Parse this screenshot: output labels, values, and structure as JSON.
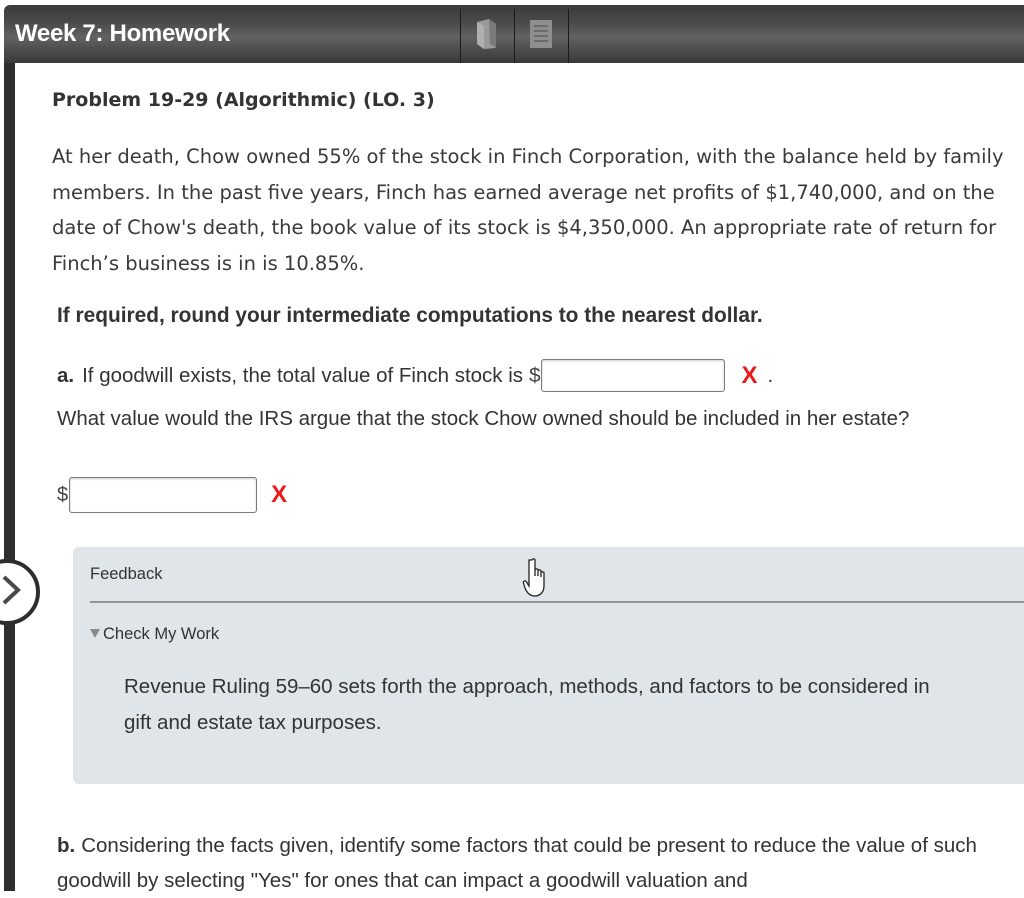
{
  "header": {
    "title": "Week 7: Homework",
    "icons": [
      "book-icon",
      "document-icon"
    ]
  },
  "problem": {
    "title": "Problem 19-29 (Algorithmic) (LO. 3)",
    "text": "At her death, Chow owned 55% of the stock in Finch Corporation, with the balance held by family members. In the past five years, Finch has earned average net profits of $1,740,000, and on the date of Chow's death, the book value of its stock is $4,350,000. An appropriate rate of return for Finch’s business is in is 10.85%.",
    "instruction": "If required, round your intermediate computations to the nearest dollar."
  },
  "part_a": {
    "label": "a.",
    "question1": "If goodwill exists, the total value of Finch stock is",
    "currency": "$",
    "answer1_value": "",
    "answer1_status": "X",
    "period": ".",
    "question2": "What value would the IRS argue that the stock Chow owned should be included in her estate?",
    "answer2_value": "",
    "answer2_status": "X"
  },
  "feedback": {
    "title": "Feedback",
    "toggle_label": "Check My Work",
    "text_line1": "Revenue Ruling 59–60 sets forth the approach, methods, and factors to be considered in",
    "text_line2": "gift and estate tax purposes."
  },
  "part_b": {
    "label": "b.",
    "text": "Considering the facts given, identify some factors that could be present to reduce the value of such goodwill by selecting \"Yes\" for ones that can impact a goodwill valuation and"
  },
  "colors": {
    "error": "#e81a1a",
    "feedback_bg": "#dfe5e8",
    "header_bg": "#4a4a4a"
  }
}
